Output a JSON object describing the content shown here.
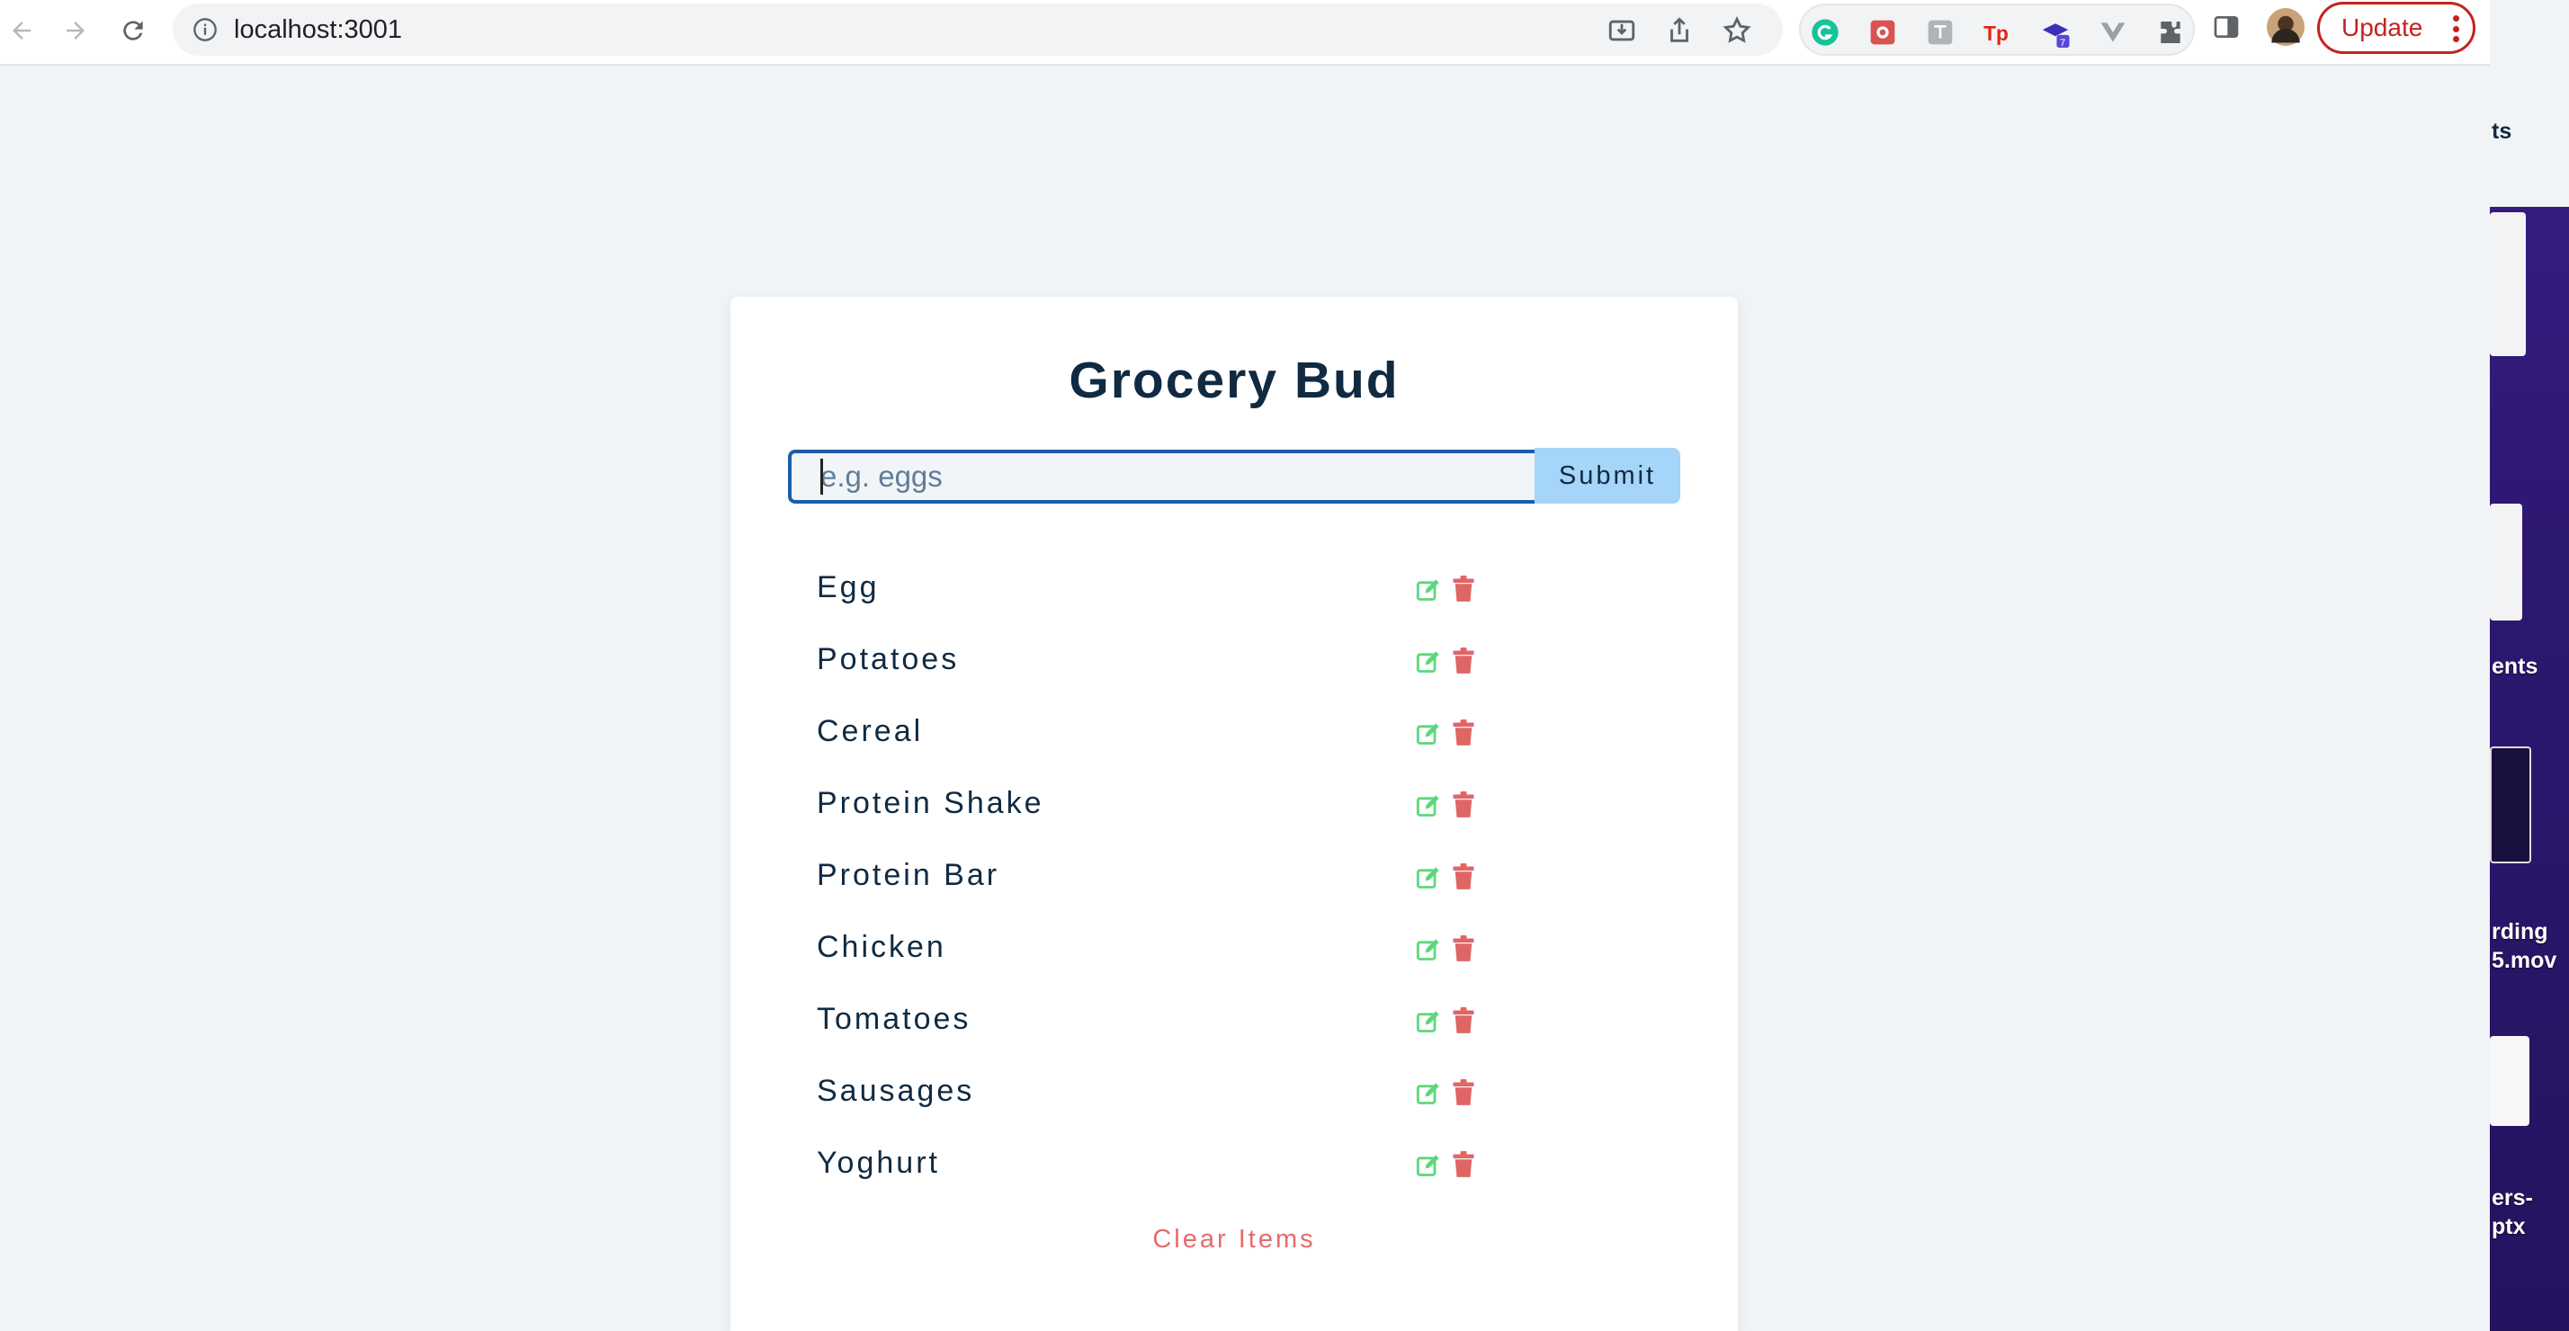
{
  "browser": {
    "url": "localhost:3001",
    "update_label": "Update",
    "extension_badge": "7"
  },
  "desktop": {
    "labels": [
      "ts",
      "ents",
      "rding",
      "5.mov",
      "ers-",
      "ptx"
    ]
  },
  "app": {
    "title": "Grocery Bud",
    "input_placeholder": "e.g. eggs",
    "input_value": "",
    "submit_label": "Submit",
    "items": [
      {
        "name": "Egg"
      },
      {
        "name": "Potatoes"
      },
      {
        "name": "Cereal"
      },
      {
        "name": "Protein Shake"
      },
      {
        "name": "Protein Bar"
      },
      {
        "name": "Chicken"
      },
      {
        "name": "Tomatoes"
      },
      {
        "name": "Sausages"
      },
      {
        "name": "Yoghurt"
      }
    ],
    "clear_label": "Clear Items"
  },
  "colors": {
    "title": "#102a42",
    "edit_icon": "#5dd77c",
    "delete_icon": "#e06666",
    "submit_bg": "#a5d5f8",
    "clear_text": "#e66b6b"
  }
}
